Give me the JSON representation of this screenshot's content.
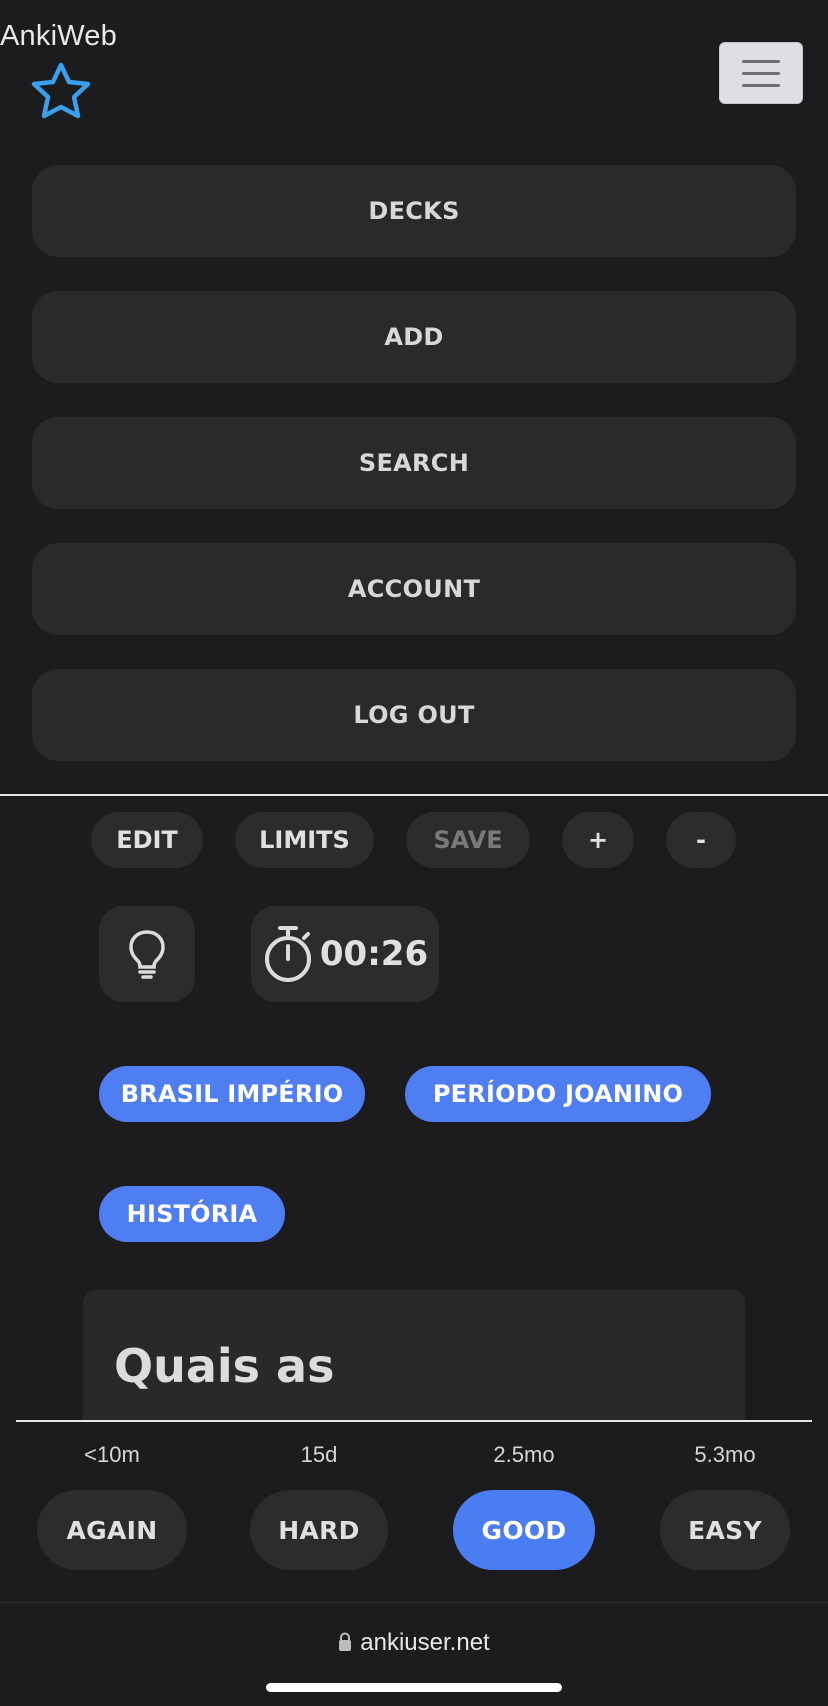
{
  "brand": {
    "name": "AnkiWeb",
    "accent_color": "#3aa0ee"
  },
  "nav": {
    "items": [
      "DECKS",
      "ADD",
      "SEARCH",
      "ACCOUNT",
      "LOG OUT"
    ]
  },
  "toolbar": {
    "edit": "EDIT",
    "limits": "LIMITS",
    "save": "SAVE",
    "plus": "+",
    "minus": "-"
  },
  "timer": {
    "value": "00:26",
    "icon": "stopwatch-icon"
  },
  "hint": {
    "icon": "lightbulb-icon"
  },
  "tags": [
    "BRASIL IMPÉRIO",
    "PERÍODO JOANINO",
    "HISTÓRIA"
  ],
  "card": {
    "question": "Quais as consequências da"
  },
  "answers": [
    {
      "interval": "<10m",
      "label": "AGAIN"
    },
    {
      "interval": "15d",
      "label": "HARD"
    },
    {
      "interval": "2.5mo",
      "label": "GOOD"
    },
    {
      "interval": "5.3mo",
      "label": "EASY"
    }
  ],
  "browser": {
    "url": "ankiuser.net"
  },
  "colors": {
    "tag": "#4f7df2",
    "primary_button": "#4a7cf2",
    "background": "#1c1c1e"
  }
}
